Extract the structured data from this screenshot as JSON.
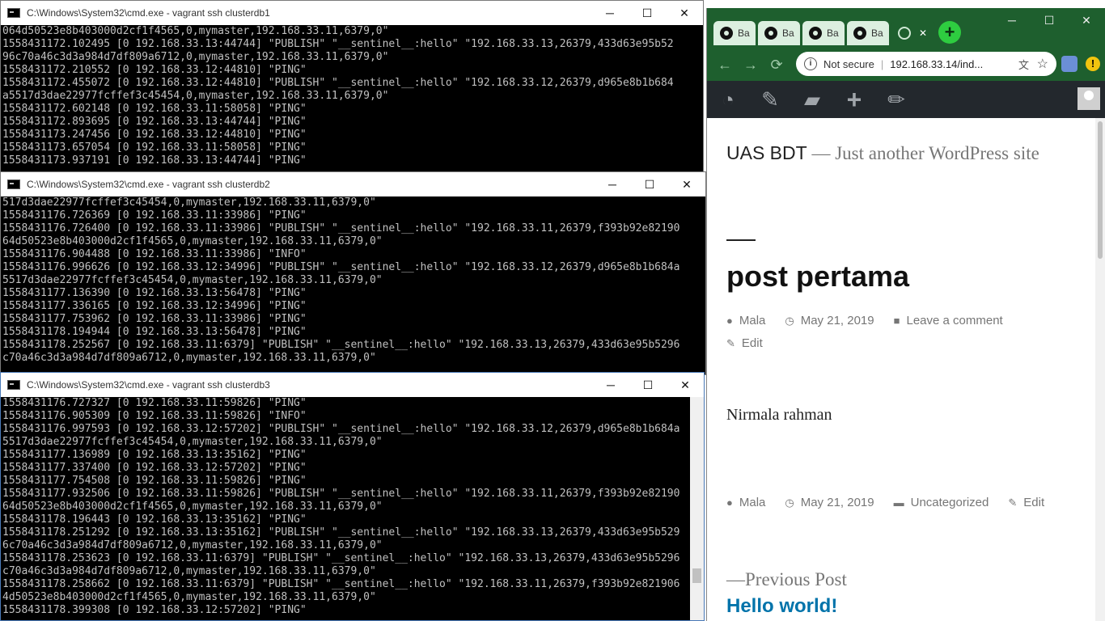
{
  "windows": {
    "controls": {
      "minimize": "─",
      "maximize": "☐",
      "close": "✕"
    },
    "cmd1": {
      "title": "C:\\Windows\\System32\\cmd.exe - vagrant  ssh clusterdb1",
      "text": "064d50523e8b403000d2cf1f4565,0,mymaster,192.168.33.11,6379,0\"\n1558431172.102495 [0 192.168.33.13:44744] \"PUBLISH\" \"__sentinel__:hello\" \"192.168.33.13,26379,433d63e95b52\n96c70a46c3d3a984d7df809a6712,0,mymaster,192.168.33.11,6379,0\"\n1558431172.210552 [0 192.168.33.12:44810] \"PING\"\n1558431172.455072 [0 192.168.33.12:44810] \"PUBLISH\" \"__sentinel__:hello\" \"192.168.33.12,26379,d965e8b1b684\na5517d3dae22977fcffef3c45454,0,mymaster,192.168.33.11,6379,0\"\n1558431172.602148 [0 192.168.33.11:58058] \"PING\"\n1558431172.893695 [0 192.168.33.13:44744] \"PING\"\n1558431173.247456 [0 192.168.33.12:44810] \"PING\"\n1558431173.657054 [0 192.168.33.11:58058] \"PING\"\n1558431173.937191 [0 192.168.33.13:44744] \"PING\""
    },
    "cmd2": {
      "title": "C:\\Windows\\System32\\cmd.exe - vagrant  ssh clusterdb2",
      "text": "517d3dae22977fcffef3c45454,0,mymaster,192.168.33.11,6379,0\"\n1558431176.726369 [0 192.168.33.11:33986] \"PING\"\n1558431176.726400 [0 192.168.33.11:33986] \"PUBLISH\" \"__sentinel__:hello\" \"192.168.33.11,26379,f393b92e82190\n64d50523e8b403000d2cf1f4565,0,mymaster,192.168.33.11,6379,0\"\n1558431176.904488 [0 192.168.33.11:33986] \"INFO\"\n1558431176.996626 [0 192.168.33.12:34996] \"PUBLISH\" \"__sentinel__:hello\" \"192.168.33.12,26379,d965e8b1b684a\n5517d3dae22977fcffef3c45454,0,mymaster,192.168.33.11,6379,0\"\n1558431177.136390 [0 192.168.33.13:56478] \"PING\"\n1558431177.336165 [0 192.168.33.12:34996] \"PING\"\n1558431177.753962 [0 192.168.33.11:33986] \"PING\"\n1558431178.194944 [0 192.168.33.13:56478] \"PING\"\n1558431178.252567 [0 192.168.33.11:6379] \"PUBLISH\" \"__sentinel__:hello\" \"192.168.33.13,26379,433d63e95b5296\nc70a46c3d3a984d7df809a6712,0,mymaster,192.168.33.11,6379,0\""
    },
    "cmd3": {
      "title": "C:\\Windows\\System32\\cmd.exe - vagrant  ssh clusterdb3",
      "text": "1558431176.727327 [0 192.168.33.11:59826] \"PING\"\n1558431176.905309 [0 192.168.33.11:59826] \"INFO\"\n1558431176.997593 [0 192.168.33.12:57202] \"PUBLISH\" \"__sentinel__:hello\" \"192.168.33.12,26379,d965e8b1b684a\n5517d3dae22977fcffef3c45454,0,mymaster,192.168.33.11,6379,0\"\n1558431177.136989 [0 192.168.33.13:35162] \"PING\"\n1558431177.337400 [0 192.168.33.12:57202] \"PING\"\n1558431177.754508 [0 192.168.33.11:59826] \"PING\"\n1558431177.932506 [0 192.168.33.11:59826] \"PUBLISH\" \"__sentinel__:hello\" \"192.168.33.11,26379,f393b92e82190\n64d50523e8b403000d2cf1f4565,0,mymaster,192.168.33.11,6379,0\"\n1558431178.196443 [0 192.168.33.13:35162] \"PING\"\n1558431178.251292 [0 192.168.33.13:35162] \"PUBLISH\" \"__sentinel__:hello\" \"192.168.33.13,26379,433d63e95b529\n6c70a46c3d3a984d7df809a6712,0,mymaster,192.168.33.11,6379,0\"\n1558431178.253623 [0 192.168.33.11:6379] \"PUBLISH\" \"__sentinel__:hello\" \"192.168.33.13,26379,433d63e95b5296\nc70a46c3d3a984d7df809a6712,0,mymaster,192.168.33.11,6379,0\"\n1558431178.258662 [0 192.168.33.11:6379] \"PUBLISH\" \"__sentinel__:hello\" \"192.168.33.11,26379,f393b92e821906\n4d50523e8b403000d2cf1f4565,0,mymaster,192.168.33.11,6379,0\"\n1558431178.399308 [0 192.168.33.12:57202] \"PING\""
    }
  },
  "browser": {
    "tabs": [
      {
        "label": "Ba",
        "icon": "github-icon"
      },
      {
        "label": "Ba",
        "icon": "github-icon"
      },
      {
        "label": "Ba",
        "icon": "github-icon"
      },
      {
        "label": "Ba",
        "icon": "github-icon"
      }
    ],
    "active_tab_close": "✕",
    "new_tab": "+",
    "nav": {
      "back": "←",
      "forward": "→",
      "reload": "⟳"
    },
    "address": {
      "security": "Not secure",
      "separator": "|",
      "url": "192.168.33.14/ind...",
      "info_icon": "i"
    },
    "menu_badge": "!",
    "theme_color": "#1e5f2e"
  },
  "wp": {
    "adminbar_icons": [
      "dashboard-icon",
      "customize-brush-icon",
      "comments-icon",
      "new-plus-icon",
      "edit-pencil-icon"
    ],
    "site_title": "UAS BDT",
    "site_desc_sep": " — ",
    "site_desc": "Just another WordPress site",
    "post_title": "post pertama",
    "meta_top": {
      "author": "Mala",
      "date": "May 21, 2019",
      "comment": "Leave a comment",
      "edit": "Edit"
    },
    "content": "Nirmala rahman",
    "meta_bottom": {
      "author": "Mala",
      "date": "May 21, 2019",
      "category": "Uncategorized",
      "edit": "Edit"
    },
    "prev_label": "—Previous Post",
    "prev_title": "Hello world!"
  }
}
